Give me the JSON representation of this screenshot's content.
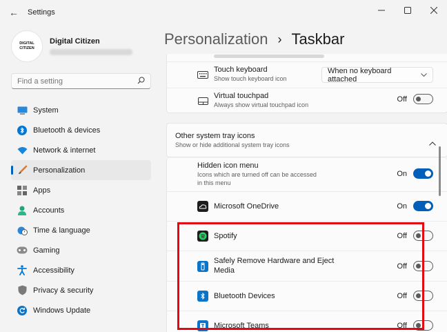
{
  "window": {
    "title": "Settings"
  },
  "profile": {
    "name": "Digital Citizen",
    "avatar_line1": "DIGITAL",
    "avatar_line2": "CITIZEN"
  },
  "search": {
    "placeholder": "Find a setting"
  },
  "nav": [
    {
      "label": "System",
      "icon": "monitor-icon"
    },
    {
      "label": "Bluetooth & devices",
      "icon": "bluetooth-icon"
    },
    {
      "label": "Network & internet",
      "icon": "wifi-icon"
    },
    {
      "label": "Personalization",
      "icon": "brush-icon",
      "active": true
    },
    {
      "label": "Apps",
      "icon": "apps-icon"
    },
    {
      "label": "Accounts",
      "icon": "person-icon"
    },
    {
      "label": "Time & language",
      "icon": "globe-clock-icon"
    },
    {
      "label": "Gaming",
      "icon": "gamepad-icon"
    },
    {
      "label": "Accessibility",
      "icon": "accessibility-icon"
    },
    {
      "label": "Privacy & security",
      "icon": "shield-icon"
    },
    {
      "label": "Windows Update",
      "icon": "update-icon"
    }
  ],
  "breadcrumb": {
    "parent": "Personalization",
    "separator": "›",
    "current": "Taskbar"
  },
  "touch_keyboard": {
    "title": "Touch keyboard",
    "subtitle": "Show touch keyboard icon",
    "value": "When no keyboard attached"
  },
  "virtual_touchpad": {
    "title": "Virtual touchpad",
    "subtitle": "Always show virtual touchpad icon",
    "state": "Off"
  },
  "tray_section": {
    "title": "Other system tray icons",
    "subtitle": "Show or hide additional system tray icons"
  },
  "tray_items": [
    {
      "title": "Hidden icon menu",
      "subtitle": "Icons which are turned off can be accessed in this menu",
      "state": "On"
    },
    {
      "title": "Microsoft OneDrive",
      "state": "On",
      "icon": "onedrive-icon"
    },
    {
      "title": "Spotify",
      "state": "Off",
      "icon": "spotify-icon"
    },
    {
      "title": "Safely Remove Hardware and Eject Media",
      "state": "Off",
      "icon": "usb-icon"
    },
    {
      "title": "Bluetooth Devices",
      "state": "Off",
      "icon": "bluetooth-icon"
    },
    {
      "title": "Microsoft Teams",
      "state": "Off",
      "icon": "teams-icon"
    }
  ],
  "colors": {
    "accent": "#005fb8",
    "highlight": "#e30613"
  }
}
